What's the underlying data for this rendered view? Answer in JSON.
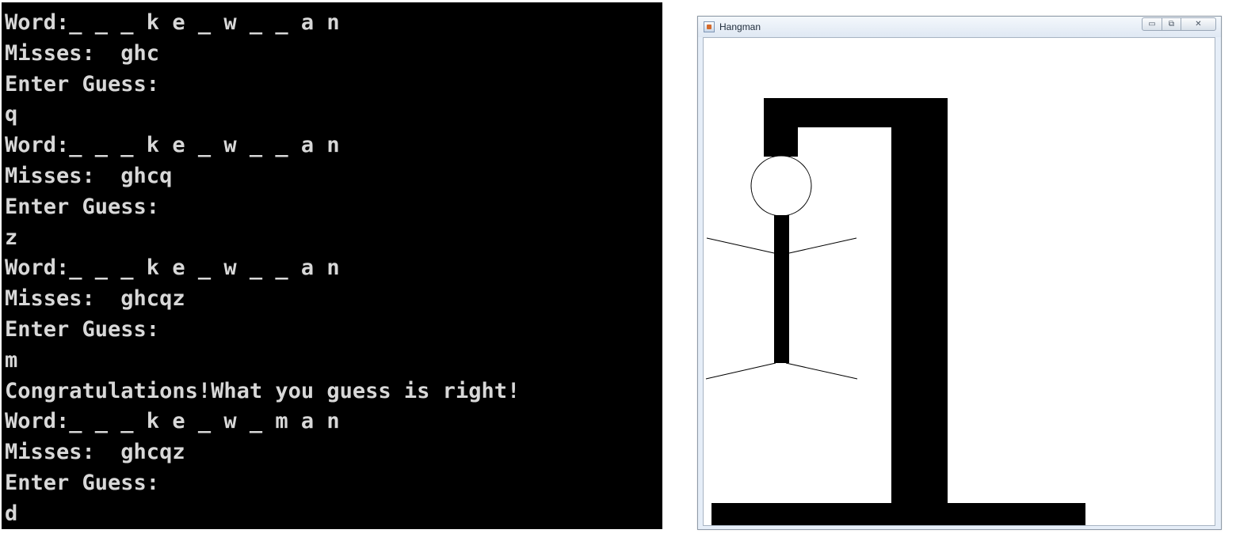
{
  "console": {
    "lines": [
      "Word:_ _ _ k e _ w _ _ a n",
      "Misses:  ghc",
      "Enter Guess:",
      "q",
      "Word:_ _ _ k e _ w _ _ a n",
      "Misses:  ghcq",
      "Enter Guess:",
      "z",
      "Word:_ _ _ k e _ w _ _ a n",
      "Misses:  ghcqz",
      "Enter Guess:",
      "m",
      "Congratulations!What you guess is right!",
      "Word:_ _ _ k e _ w _ m a n",
      "Misses:  ghcqz",
      "Enter Guess:",
      "d"
    ]
  },
  "window": {
    "title": "Hangman",
    "app_icon": "java-app-icon",
    "minimize_icon": "minimize-icon",
    "maximize_icon": "maximize-icon",
    "close_icon": "close-icon",
    "minimize_glyph": "▭",
    "maximize_glyph": "⧉",
    "close_glyph": "✕"
  },
  "colors": {
    "console_bg": "#000000",
    "console_text": "#d8d8d8",
    "canvas_bg": "#ffffff",
    "gallows": "#000000"
  }
}
